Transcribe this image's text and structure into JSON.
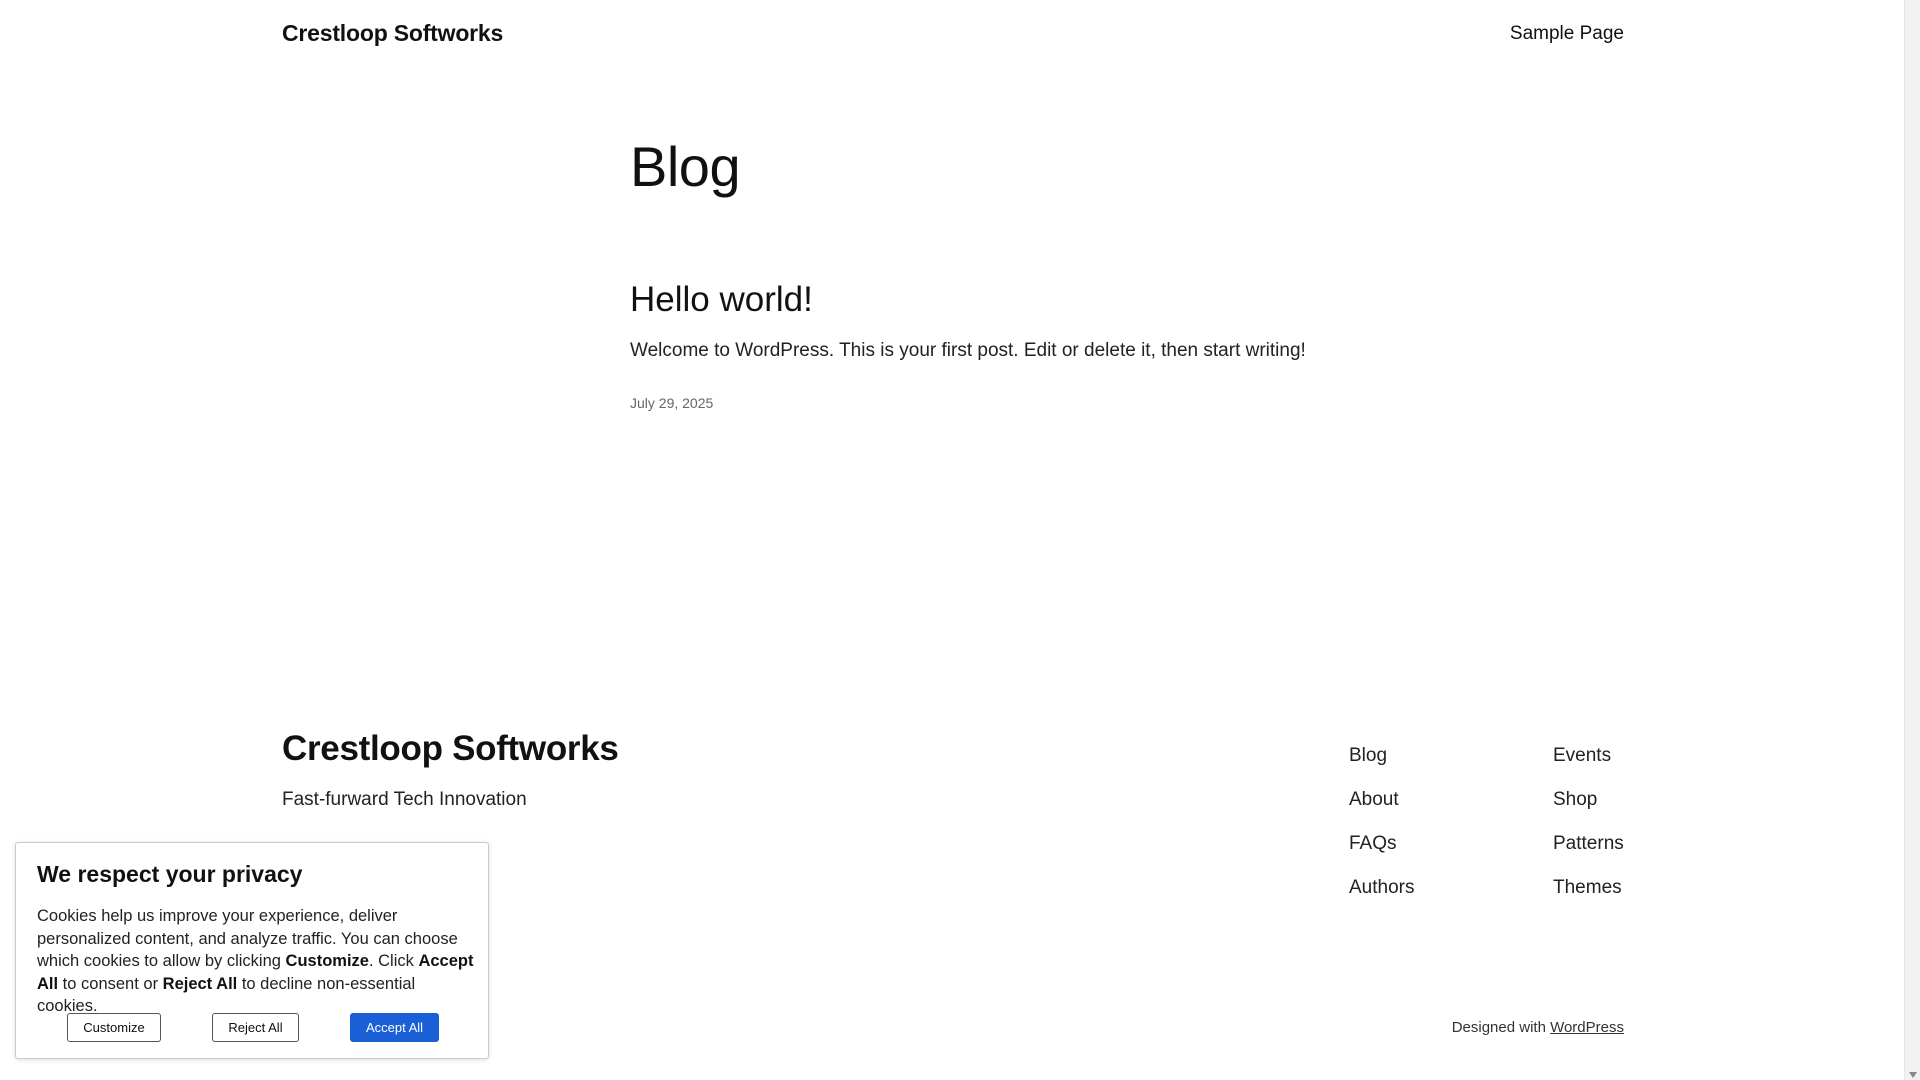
{
  "header": {
    "site_title": "Crestloop Softworks",
    "nav": [
      "Sample Page"
    ]
  },
  "main": {
    "page_title": "Blog",
    "post": {
      "title": "Hello world!",
      "excerpt": "Welcome to WordPress. This is your first post. Edit or delete it, then start writing!",
      "date": "July 29, 2025"
    }
  },
  "footer": {
    "site_title": "Crestloop Softworks",
    "tagline": "Fast-furward Tech Innovation",
    "col1": [
      "Blog",
      "About",
      "FAQs",
      "Authors"
    ],
    "col2": [
      "Events",
      "Shop",
      "Patterns",
      "Themes"
    ],
    "credit_prefix": "Designed with ",
    "credit_link": "WordPress"
  },
  "cookie": {
    "heading": "We respect your privacy",
    "text_1": "Cookies help us improve your experience, deliver personalized content, and analyze traffic. You can choose which cookies to allow by clicking ",
    "text_customize": "Customize",
    "text_2": ". Click ",
    "text_accept": "Accept All",
    "text_3": " to consent or ",
    "text_reject": "Reject All",
    "text_4": " to decline non-essential cookies.",
    "buttons": {
      "customize": "Customize",
      "reject": "Reject All",
      "accept": "Accept All"
    },
    "accent_color": "#1a5fd6"
  }
}
